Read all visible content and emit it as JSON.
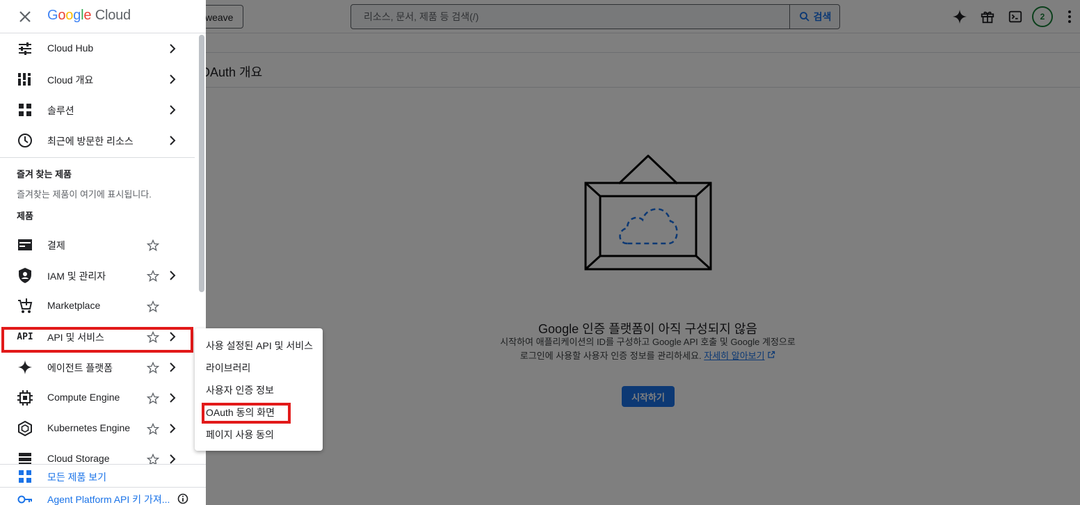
{
  "topbar": {
    "project_label": "weave",
    "search_placeholder": "리소스, 문서, 제품 등 검색(/)",
    "search_button": "검색",
    "avatar_count": "2"
  },
  "page": {
    "title": "OAuth 개요",
    "empty_title": "Google 인증 플랫폼이 아직 구성되지 않음",
    "empty_desc_line1": "시작하여 애플리케이션의 ID를 구성하고 Google API 호출 및 Google 계정으로",
    "empty_desc_line2": "로그인에 사용할 사용자 인증 정보를 관리하세요.",
    "learn_more": "자세히 알아보기",
    "start_button": "시작하기"
  },
  "drawer": {
    "logo_google": [
      "G",
      "o",
      "o",
      "g",
      "l",
      "e"
    ],
    "logo_cloud": "Cloud",
    "top_items": [
      {
        "label": "Cloud Hub",
        "icon": "tune-icon"
      },
      {
        "label": "Cloud 개요",
        "icon": "dashboard-icon"
      },
      {
        "label": "솔루션",
        "icon": "grid-icon"
      },
      {
        "label": "최근에 방문한 리소스",
        "icon": "clock-icon"
      }
    ],
    "favorites_title": "즐겨 찾는 제품",
    "favorites_empty": "즐겨찾는 제품이 여기에 표시됩니다.",
    "products_title": "제품",
    "products": [
      {
        "label": "결제",
        "icon": "billing-icon"
      },
      {
        "label": "IAM 및 관리자",
        "icon": "shield-icon"
      },
      {
        "label": "Marketplace",
        "icon": "cart-icon"
      },
      {
        "label": "API 및 서비스",
        "icon": "api-icon",
        "icon_text": "API"
      },
      {
        "label": "에이전트 플랫폼",
        "icon": "sparkle-icon"
      },
      {
        "label": "Compute Engine",
        "icon": "chip-icon"
      },
      {
        "label": "Kubernetes Engine",
        "icon": "kubernetes-icon"
      },
      {
        "label": "Cloud Storage",
        "icon": "storage-icon"
      }
    ],
    "footer": {
      "all_products": "모든 제품 보기",
      "agent_api": "Agent Platform API 키 가져..."
    }
  },
  "submenu": {
    "items": [
      "사용 설정된 API 및 서비스",
      "라이브러리",
      "사용자 인증 정보",
      "OAuth 동의 화면",
      "페이지 사용 동의"
    ]
  },
  "colors": {
    "accent": "#1a73e8",
    "highlight": "#e21a1a",
    "scrim": "#808080"
  }
}
